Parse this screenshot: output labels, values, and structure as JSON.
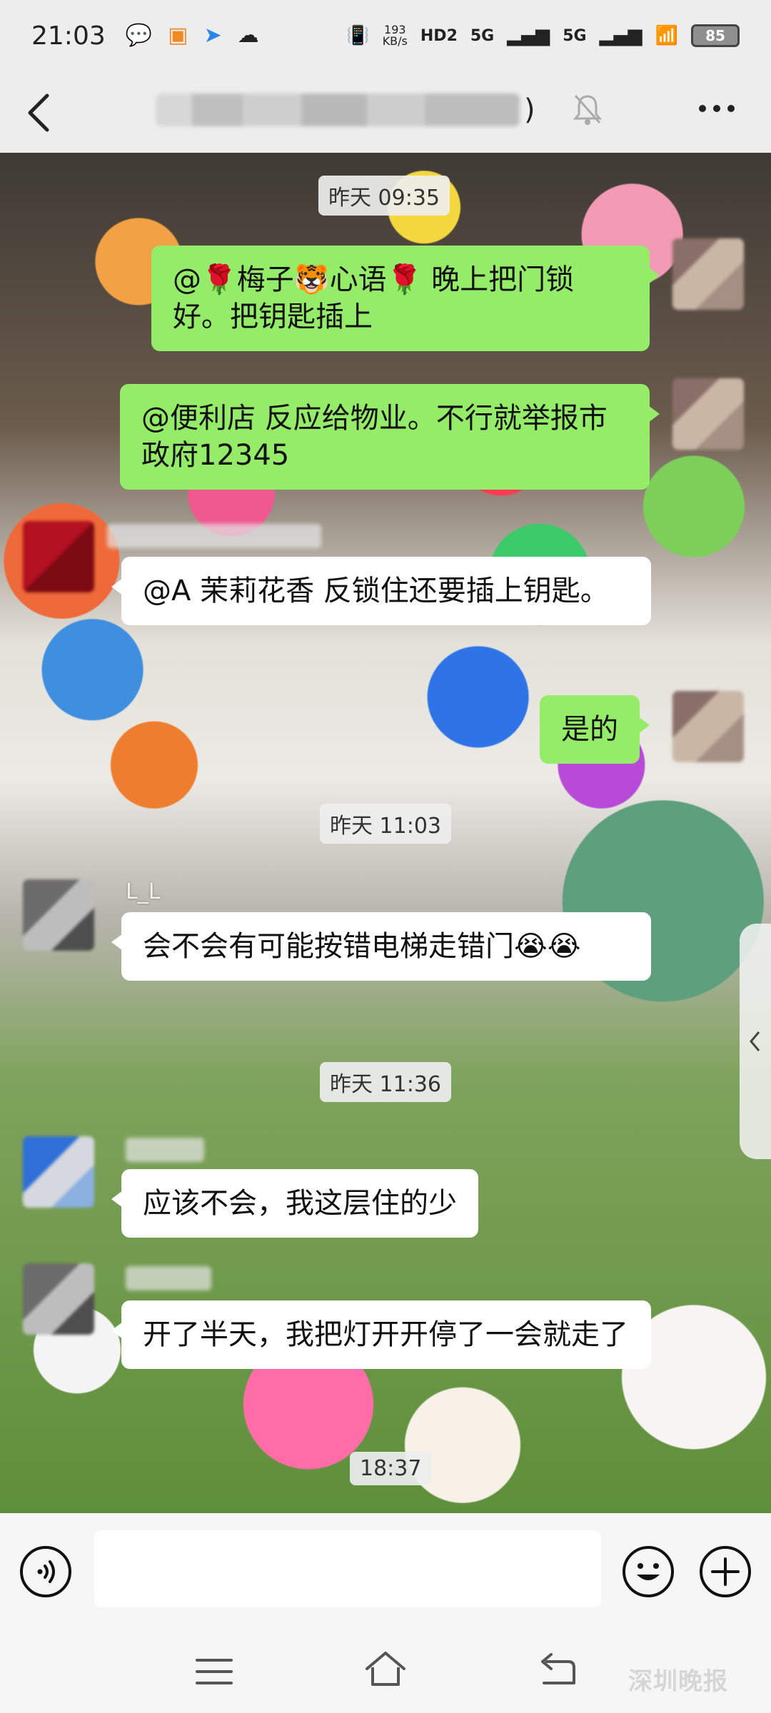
{
  "status_bar": {
    "time": "21:03",
    "net_speed_value": "193",
    "net_speed_unit": "KB/s",
    "hd": "HD2",
    "sim1": "5G",
    "sim2": "5G",
    "battery": "85"
  },
  "header": {
    "title_tail": ")"
  },
  "messages": {
    "t1": "昨天 09:35",
    "m1": "@🌹梅子🐯心语🌹  晚上把门锁好。把钥匙插上",
    "m2": "@便利店  反应给物业。不行就举报市政府12345",
    "m3": "@A 茉莉花香  反锁住还要插上钥匙。",
    "m4": "是的",
    "t2": "昨天 11:03",
    "m5_sender": "L_L",
    "m5": "会不会有可能按错电梯走错门😭😭",
    "t3": "昨天 11:36",
    "m6": "应该不会，我这层住的少",
    "m7": "开了半天，我把灯开开停了一会就走了",
    "t4": "18:37"
  },
  "input": {
    "placeholder": ""
  },
  "watermark": "深圳晚报",
  "colors": {
    "outgoing_bubble": "#95ec69",
    "incoming_bubble": "#ffffff",
    "bar_bg": "#ededed"
  },
  "icons": [
    "back-icon",
    "mute-icon",
    "more-icon",
    "voice-icon",
    "emoji-icon",
    "plus-icon",
    "menu-icon",
    "home-icon",
    "nav-back-icon",
    "chevron-left-icon"
  ]
}
